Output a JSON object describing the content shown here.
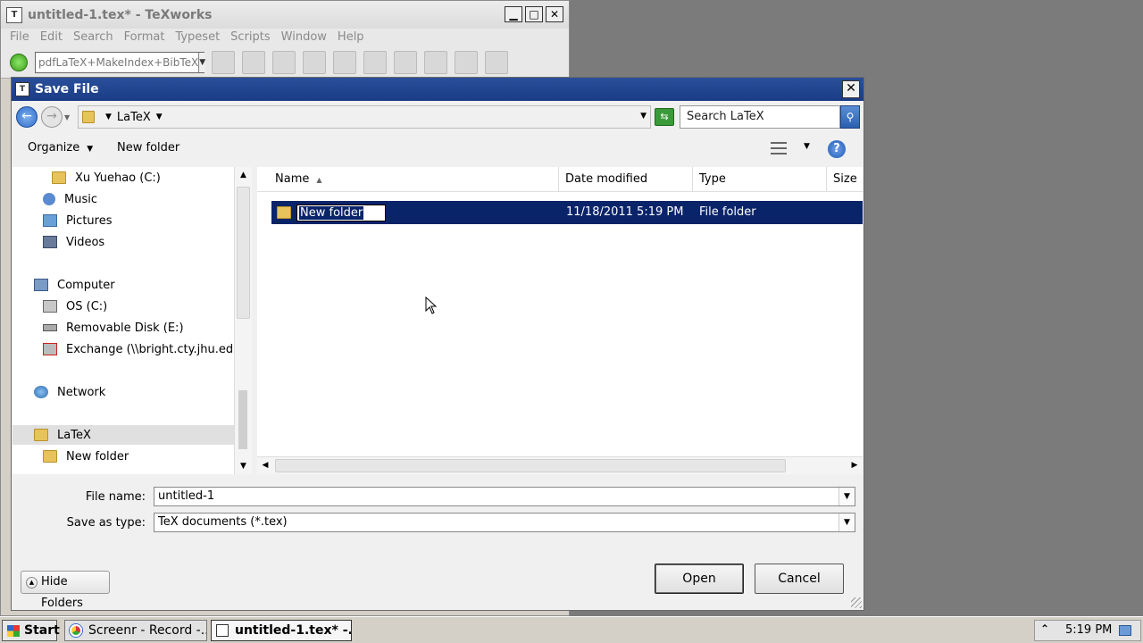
{
  "texworks": {
    "title": "untitled-1.tex* - TeXworks",
    "menu": [
      "File",
      "Edit",
      "Search",
      "Format",
      "Typeset",
      "Scripts",
      "Window",
      "Help"
    ],
    "typeset_engine": "pdfLaTeX+MakeIndex+BibTeX"
  },
  "dialog": {
    "title": "Save File",
    "close_label": "✕",
    "address": {
      "crumb": "LaTeX",
      "search_placeholder": "Search LaTeX"
    },
    "toolbar": {
      "organize_label": "Organize",
      "new_folder_label": "New folder"
    },
    "nav_items": [
      {
        "label": "Xu Yuehao (C:)",
        "icon": "folder-icon"
      },
      {
        "label": "Music",
        "icon": "music-icon"
      },
      {
        "label": "Pictures",
        "icon": "pictures-icon"
      },
      {
        "label": "Videos",
        "icon": "videos-icon"
      },
      {
        "label": "Computer",
        "icon": "computer-icon"
      },
      {
        "label": "OS (C:)",
        "icon": "drive-icon"
      },
      {
        "label": "Removable Disk (E:)",
        "icon": "removable-disk-icon"
      },
      {
        "label": "Exchange (\\\\bright.cty.jhu.edu",
        "icon": "network-drive-icon"
      },
      {
        "label": "Network",
        "icon": "network-icon"
      },
      {
        "label": "LaTeX",
        "icon": "folder-icon"
      },
      {
        "label": "New folder",
        "icon": "folder-icon"
      }
    ],
    "columns": {
      "name": "Name",
      "date_modified": "Date modified",
      "type": "Type",
      "size": "Size"
    },
    "files": [
      {
        "name": "New folder",
        "date_modified": "11/18/2011 5:19 PM",
        "type": "File folder"
      }
    ],
    "file_name_label": "File name:",
    "file_name_value": "untitled-1",
    "save_as_type_label": "Save as type:",
    "save_as_type_value": "TeX documents (*.tex)",
    "hide_folders_label": "Hide Folders",
    "open_label": "Open",
    "cancel_label": "Cancel"
  },
  "taskbar": {
    "start_label": "Start",
    "tasks": [
      {
        "label": "Screenr - Record -...",
        "icon": "chrome-icon"
      },
      {
        "label": "untitled-1.tex* -...",
        "icon": "texworks-icon"
      }
    ],
    "clock": "5:19 PM"
  }
}
